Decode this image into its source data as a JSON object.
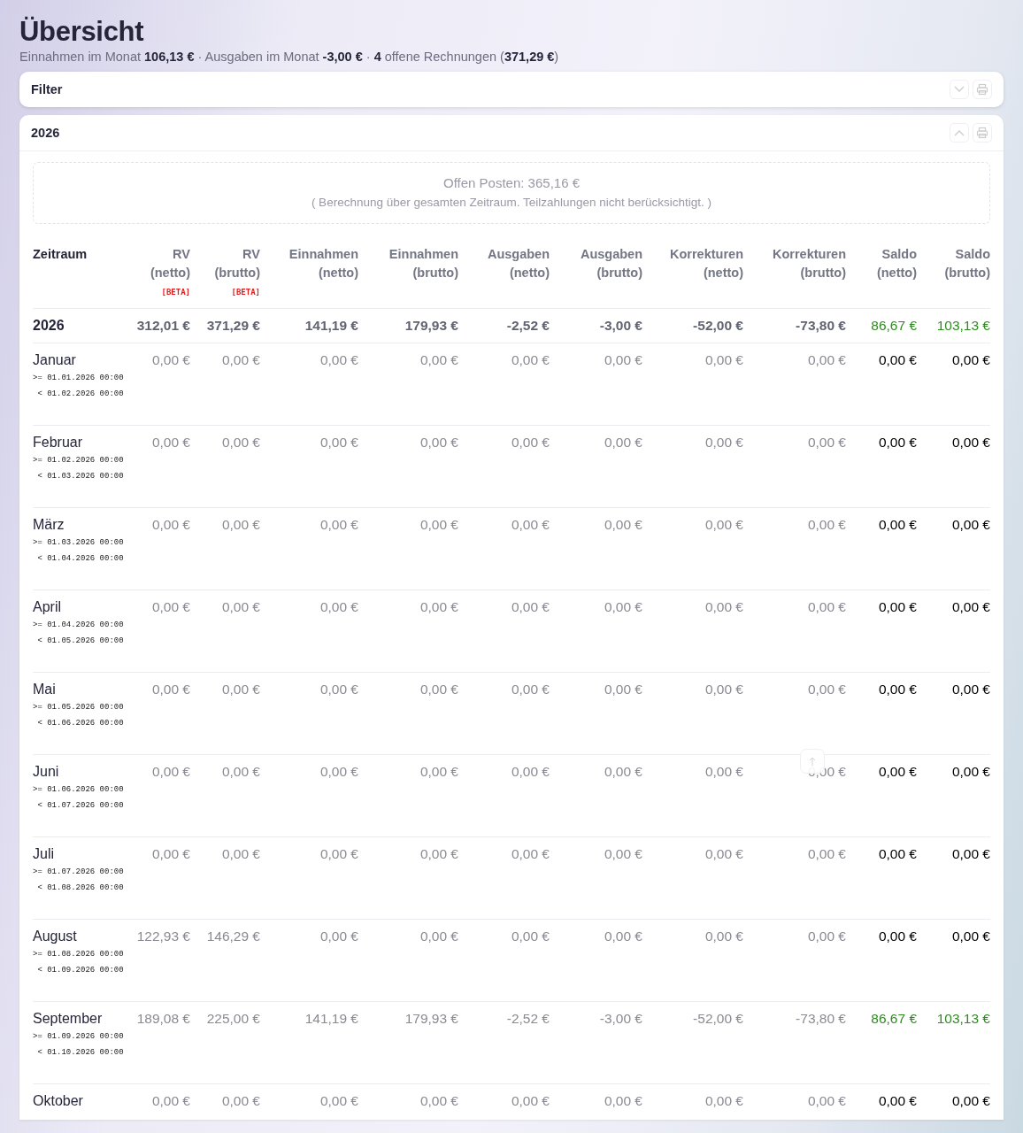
{
  "page": {
    "title": "Übersicht",
    "summary": "Einnahmen im Monat **106,13 €** · Ausgaben im Monat **-3,00 €** · **4** offene Rechnungen (**371,29 €**)"
  },
  "filter_panel": {
    "title": "Filter",
    "expanded": false
  },
  "year_panel": {
    "title": "2026",
    "expanded": true,
    "open_items": {
      "text": "Offen Posten: 365,16 €",
      "note": "( Berechnung über gesamten Zeitraum. Teilzahlungen nicht berücksichtigt. )"
    },
    "table": {
      "columns": [
        {
          "label": "Zeitraum"
        },
        {
          "label": "RV",
          "sub": "(netto)",
          "badge": "[BETA]"
        },
        {
          "label": "RV",
          "sub": "(brutto)",
          "badge": "[BETA]"
        },
        {
          "label": "Einnahmen",
          "sub": "(netto)"
        },
        {
          "label": "Einnahmen",
          "sub": "(brutto)"
        },
        {
          "label": "Ausgaben",
          "sub": "(netto)"
        },
        {
          "label": "Ausgaben",
          "sub": "(brutto)"
        },
        {
          "label": "Korrekturen",
          "sub": "(netto)"
        },
        {
          "label": "Korrekturen",
          "sub": "(brutto)"
        },
        {
          "label": "Saldo",
          "sub": "(netto)"
        },
        {
          "label": "Saldo",
          "sub": "(brutto)"
        }
      ],
      "total_row": {
        "label": "2026",
        "values": [
          "312,01 €",
          "371,29 €",
          "141,19 €",
          "179,93 €",
          "-2,52 €",
          "-3,00 €",
          "-52,00 €",
          "-73,80 €"
        ],
        "saldo": [
          {
            "value": "86,67 €",
            "color": "#2e8b1f"
          },
          {
            "value": "103,13 €",
            "color": "#2e8b1f"
          }
        ]
      },
      "rows": [
        {
          "label": "Januar",
          "from": ">= 01.01.2026 00:00",
          "to": "< 01.02.2026 00:00",
          "values": [
            "0,00 €",
            "0,00 €",
            "0,00 €",
            "0,00 €",
            "0,00 €",
            "0,00 €",
            "0,00 €",
            "0,00 €"
          ],
          "saldo": [
            {
              "value": "0,00 €",
              "color": "#000000"
            },
            {
              "value": "0,00 €",
              "color": "#000000"
            }
          ]
        },
        {
          "label": "Februar",
          "from": ">= 01.02.2026 00:00",
          "to": "< 01.03.2026 00:00",
          "values": [
            "0,00 €",
            "0,00 €",
            "0,00 €",
            "0,00 €",
            "0,00 €",
            "0,00 €",
            "0,00 €",
            "0,00 €"
          ],
          "saldo": [
            {
              "value": "0,00 €",
              "color": "#000000"
            },
            {
              "value": "0,00 €",
              "color": "#000000"
            }
          ]
        },
        {
          "label": "März",
          "from": ">= 01.03.2026 00:00",
          "to": "< 01.04.2026 00:00",
          "values": [
            "0,00 €",
            "0,00 €",
            "0,00 €",
            "0,00 €",
            "0,00 €",
            "0,00 €",
            "0,00 €",
            "0,00 €"
          ],
          "saldo": [
            {
              "value": "0,00 €",
              "color": "#000000"
            },
            {
              "value": "0,00 €",
              "color": "#000000"
            }
          ]
        },
        {
          "label": "April",
          "from": ">= 01.04.2026 00:00",
          "to": "< 01.05.2026 00:00",
          "values": [
            "0,00 €",
            "0,00 €",
            "0,00 €",
            "0,00 €",
            "0,00 €",
            "0,00 €",
            "0,00 €",
            "0,00 €"
          ],
          "saldo": [
            {
              "value": "0,00 €",
              "color": "#000000"
            },
            {
              "value": "0,00 €",
              "color": "#000000"
            }
          ]
        },
        {
          "label": "Mai",
          "from": ">= 01.05.2026 00:00",
          "to": "< 01.06.2026 00:00",
          "values": [
            "0,00 €",
            "0,00 €",
            "0,00 €",
            "0,00 €",
            "0,00 €",
            "0,00 €",
            "0,00 €",
            "0,00 €"
          ],
          "saldo": [
            {
              "value": "0,00 €",
              "color": "#000000"
            },
            {
              "value": "0,00 €",
              "color": "#000000"
            }
          ]
        },
        {
          "label": "Juni",
          "from": ">= 01.06.2026 00:00",
          "to": "< 01.07.2026 00:00",
          "values": [
            "0,00 €",
            "0,00 €",
            "0,00 €",
            "0,00 €",
            "0,00 €",
            "0,00 €",
            "0,00 €",
            "0,00 €"
          ],
          "saldo": [
            {
              "value": "0,00 €",
              "color": "#000000"
            },
            {
              "value": "0,00 €",
              "color": "#000000"
            }
          ]
        },
        {
          "label": "Juli",
          "from": ">= 01.07.2026 00:00",
          "to": "< 01.08.2026 00:00",
          "values": [
            "0,00 €",
            "0,00 €",
            "0,00 €",
            "0,00 €",
            "0,00 €",
            "0,00 €",
            "0,00 €",
            "0,00 €"
          ],
          "saldo": [
            {
              "value": "0,00 €",
              "color": "#000000"
            },
            {
              "value": "0,00 €",
              "color": "#000000"
            }
          ]
        },
        {
          "label": "August",
          "from": ">= 01.08.2026 00:00",
          "to": "< 01.09.2026 00:00",
          "values": [
            "122,93 €",
            "146,29 €",
            "0,00 €",
            "0,00 €",
            "0,00 €",
            "0,00 €",
            "0,00 €",
            "0,00 €"
          ],
          "saldo": [
            {
              "value": "0,00 €",
              "color": "#000000"
            },
            {
              "value": "0,00 €",
              "color": "#000000"
            }
          ]
        },
        {
          "label": "September",
          "from": ">= 01.09.2026 00:00",
          "to": "< 01.10.2026 00:00",
          "values": [
            "189,08 €",
            "225,00 €",
            "141,19 €",
            "179,93 €",
            "-2,52 €",
            "-3,00 €",
            "-52,00 €",
            "-73,80 €"
          ],
          "saldo": [
            {
              "value": "86,67 €",
              "color": "#2e8b1f"
            },
            {
              "value": "103,13 €",
              "color": "#2e8b1f"
            }
          ]
        },
        {
          "label": "Oktober",
          "values": [
            "0,00 €",
            "0,00 €",
            "0,00 €",
            "0,00 €",
            "0,00 €",
            "0,00 €",
            "0,00 €",
            "0,00 €"
          ],
          "saldo": [
            {
              "value": "0,00 €",
              "color": "#000000"
            },
            {
              "value": "0,00 €",
              "color": "#000000"
            }
          ]
        }
      ]
    }
  }
}
